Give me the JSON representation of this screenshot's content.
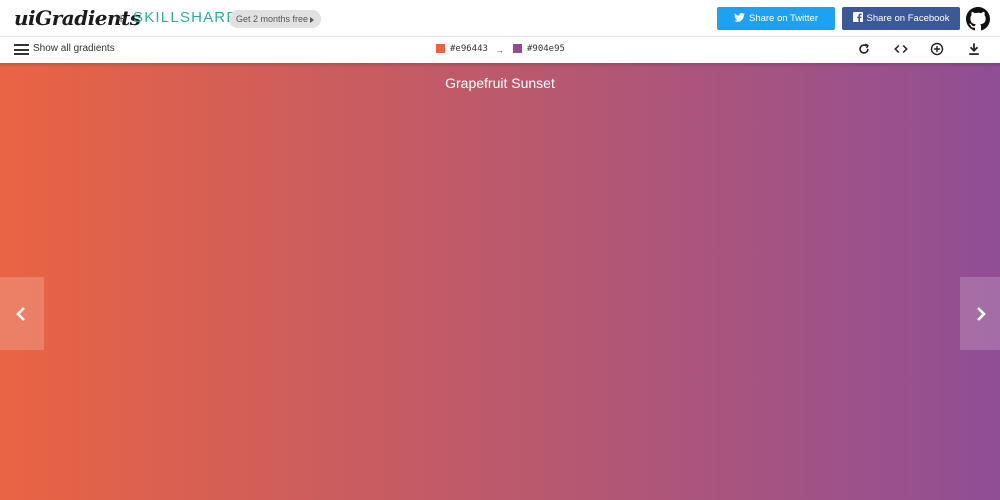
{
  "header": {
    "logo_text": "uiGradients",
    "plus": "+",
    "partner": "SKILLSHARE",
    "promo_label": "Get 2 months free",
    "twitter_label": "Share on Twitter",
    "facebook_label": "Share on Facebook"
  },
  "toolbar": {
    "menu_label": "Show all gradients",
    "color_from": "#e96443",
    "color_to": "#904e95",
    "arrow": "→"
  },
  "gradient": {
    "name": "Grapefruit Sunset",
    "from": "#e96443",
    "to": "#904e95"
  },
  "icons": [
    "menu-icon",
    "rotate-icon",
    "code-icon",
    "add-icon",
    "download-icon",
    "github-icon",
    "twitter-icon",
    "facebook-icon",
    "chevron-left-icon",
    "chevron-right-icon"
  ],
  "colors": {
    "twitter": "#1da1f2",
    "facebook": "#3b5998",
    "skillshare": "#2cae9c"
  }
}
